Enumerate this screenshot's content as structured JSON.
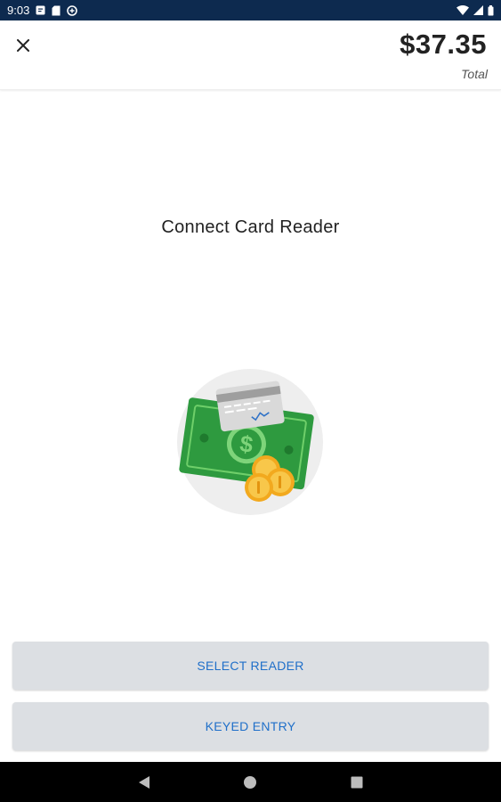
{
  "status_bar": {
    "time": "9:03",
    "background": "#0d2a4f",
    "icons_left": [
      "message-notification-icon",
      "sd-card-icon",
      "data-saver-icon"
    ],
    "icons_right": [
      "wifi-icon",
      "signal-icon",
      "battery-icon"
    ]
  },
  "header": {
    "close_icon": "close-icon",
    "total_amount": "$37.35",
    "total_label": "Total"
  },
  "main": {
    "heading": "Connect Card Reader",
    "illustration": "card-and-cash-illustration"
  },
  "actions": {
    "select_reader_label": "SELECT READER",
    "keyed_entry_label": "KEYED ENTRY",
    "button_background": "#dcdfe3",
    "label_color": "#1f6fc9"
  },
  "nav_bar": {
    "buttons": [
      "back-icon",
      "home-icon",
      "recents-icon"
    ]
  }
}
